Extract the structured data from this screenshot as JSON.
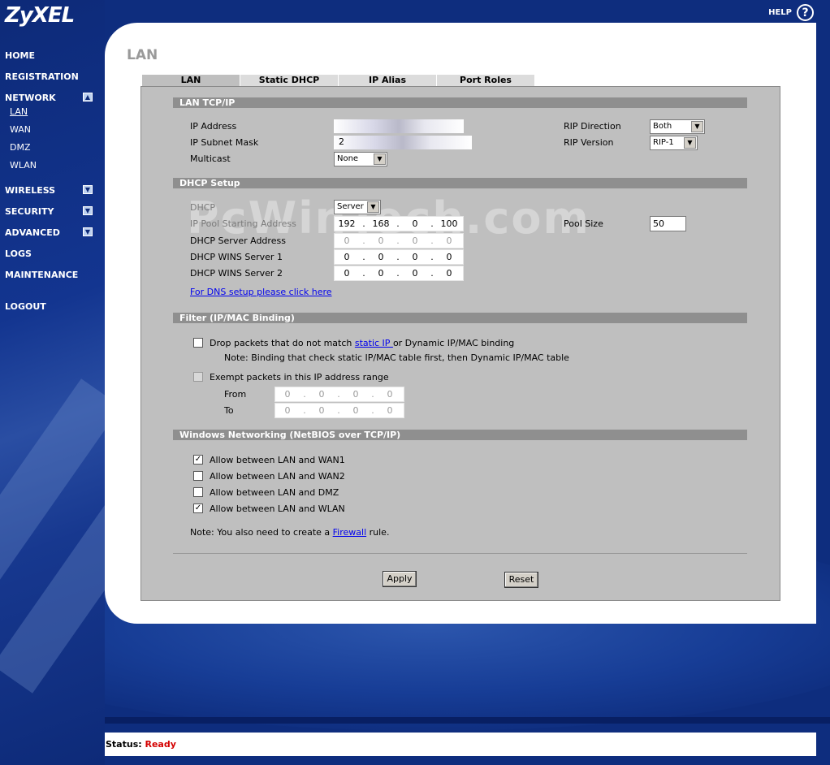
{
  "app": {
    "logo": "ZyXEL",
    "help_label": "HELP",
    "help_icon_glyph": "?"
  },
  "sidebar": {
    "items": [
      {
        "label": "HOME"
      },
      {
        "label": "REGISTRATION"
      },
      {
        "label": "NETWORK",
        "toggle": "▲"
      },
      {
        "label": "WIRELESS",
        "toggle": "▼"
      },
      {
        "label": "SECURITY",
        "toggle": "▼"
      },
      {
        "label": "ADVANCED",
        "toggle": "▼"
      },
      {
        "label": "LOGS"
      },
      {
        "label": "MAINTENANCE"
      },
      {
        "label": "LOGOUT"
      }
    ],
    "network_sub": [
      "LAN",
      "WAN",
      "DMZ",
      "WLAN"
    ]
  },
  "page": {
    "title": "LAN"
  },
  "tabs": [
    "LAN",
    "Static DHCP",
    "IP Alias",
    "Port Roles"
  ],
  "watermark": "PcWinTech.com",
  "lan_tcpip": {
    "header": "LAN TCP/IP",
    "ip_address_label": "IP Address",
    "subnet_mask_label": "IP Subnet Mask",
    "subnet_mask_prefix": "2",
    "multicast_label": "Multicast",
    "multicast_value": "None",
    "rip_direction_label": "RIP Direction",
    "rip_direction_value": "Both",
    "rip_version_label": "RIP Version",
    "rip_version_value": "RIP-1"
  },
  "dhcp": {
    "header": "DHCP Setup",
    "dhcp_label": "DHCP",
    "dhcp_value": "Server",
    "pool_start_label": "IP Pool Starting Address",
    "pool_start": [
      "192",
      "168",
      "0",
      "100"
    ],
    "pool_size_label": "Pool Size",
    "pool_size_value": "50",
    "server_address_label": "DHCP Server Address",
    "server_address": [
      "0",
      "0",
      "0",
      "0"
    ],
    "wins1_label": "DHCP WINS Server 1",
    "wins1": [
      "0",
      "0",
      "0",
      "0"
    ],
    "wins2_label": "DHCP WINS Server 2",
    "wins2": [
      "0",
      "0",
      "0",
      "0"
    ],
    "dns_link": "For DNS setup please click here"
  },
  "filter": {
    "header": "Filter (IP/MAC Binding)",
    "drop_label_pre": "Drop packets that do not match ",
    "drop_link": "static IP ",
    "drop_label_post": "or Dynamic IP/MAC binding",
    "note": "Note: Binding that check static IP/MAC table first, then Dynamic IP/MAC table",
    "exempt_label": "Exempt packets in this IP address range",
    "from_label": "From",
    "from": [
      "0",
      "0",
      "0",
      "0"
    ],
    "to_label": "To",
    "to": [
      "0",
      "0",
      "0",
      "0"
    ]
  },
  "netbios": {
    "header": "Windows Networking (NetBIOS over TCP/IP)",
    "options": [
      {
        "label": "Allow between LAN and WAN1",
        "checked": true
      },
      {
        "label": "Allow between LAN and WAN2",
        "checked": false
      },
      {
        "label": "Allow between LAN and DMZ",
        "checked": false
      },
      {
        "label": "Allow between LAN and WLAN",
        "checked": true
      }
    ],
    "note_pre": "Note: You also need to create a ",
    "note_link": "Firewall",
    "note_post": " rule."
  },
  "buttons": {
    "apply": "Apply",
    "reset": "Reset"
  },
  "status": {
    "label": "Status:",
    "value": "Ready"
  }
}
